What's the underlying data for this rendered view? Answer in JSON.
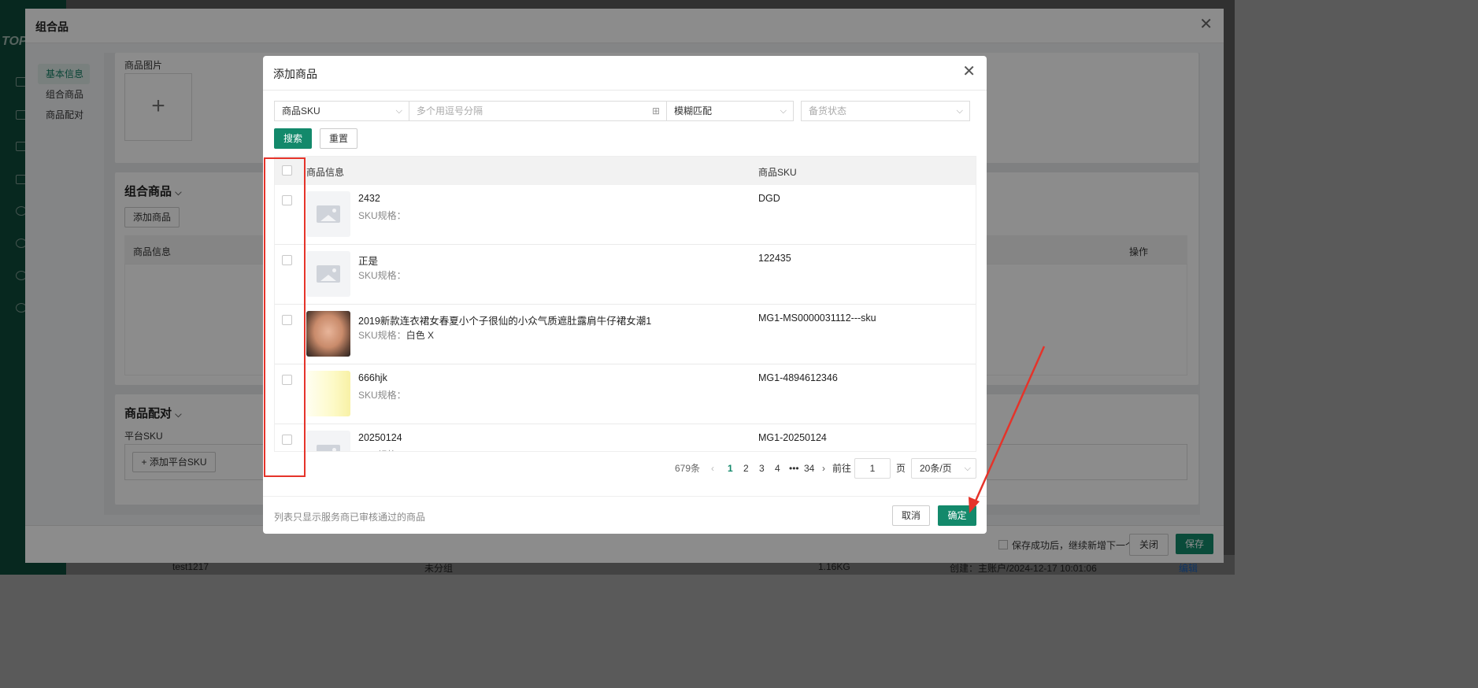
{
  "background": {
    "logo": "TOP",
    "dialog_title": "组合品",
    "left_nav": [
      "基本信息",
      "组合商品",
      "商品配对"
    ],
    "image_section_label": "商品图片",
    "combo_section_title": "组合商品",
    "add_product_button": "添加商品",
    "combo_table_headers": [
      "商品信息",
      "操作"
    ],
    "pairing_section_title": "商品配对",
    "platform_sku_label": "平台SKU",
    "add_platform_sku_button": "+ 添加平台SKU",
    "footer": {
      "keep_adding_label": "保存成功后，继续新增下一个",
      "close_button": "关闭",
      "save_button": "保存"
    },
    "bg_row": [
      "test1217",
      "未分组",
      "1.16KG",
      "创建：主账户/2024-12-17 10:01:06",
      "编辑"
    ]
  },
  "modal": {
    "title": "添加商品",
    "filters": {
      "field_select": "商品SKU",
      "search_placeholder": "多个用逗号分隔",
      "match_select": "模糊匹配",
      "status_placeholder": "备货状态"
    },
    "search_button": "搜索",
    "reset_button": "重置",
    "table": {
      "headers": [
        "商品信息",
        "商品SKU"
      ],
      "spec_label": "SKU规格：",
      "rows": [
        {
          "name": "2432",
          "spec": "",
          "sku": "DGD",
          "thumb": "placeholder-image-icon"
        },
        {
          "name": "正是",
          "spec": "",
          "sku": "122435",
          "thumb": "placeholder-image-icon"
        },
        {
          "name": "2019新款连衣裙女春夏小个子很仙的小众气质遮肚露肩牛仔裙女潮1",
          "spec": "白色 X",
          "sku": "MG1-MS0000031112---sku",
          "thumb": "photo"
        },
        {
          "name": "666hjk",
          "spec": "",
          "sku": "MG1-4894612346",
          "thumb": "yellow"
        },
        {
          "name": "20250124",
          "spec": "",
          "sku": "MG1-20250124",
          "thumb": "placeholder-image-icon"
        }
      ]
    },
    "pagination": {
      "total": "679条",
      "pages": [
        "1",
        "2",
        "3",
        "4",
        "•••",
        "34"
      ],
      "current": "1",
      "goto_label": "前往",
      "goto_value": "1",
      "page_suffix": "页",
      "page_size": "20条/页"
    },
    "footer_note": "列表只显示服务商已审核通过的商品",
    "cancel_button": "取消",
    "confirm_button": "确定"
  },
  "colors": {
    "primary": "#13896b",
    "annotation": "#e5332a"
  }
}
